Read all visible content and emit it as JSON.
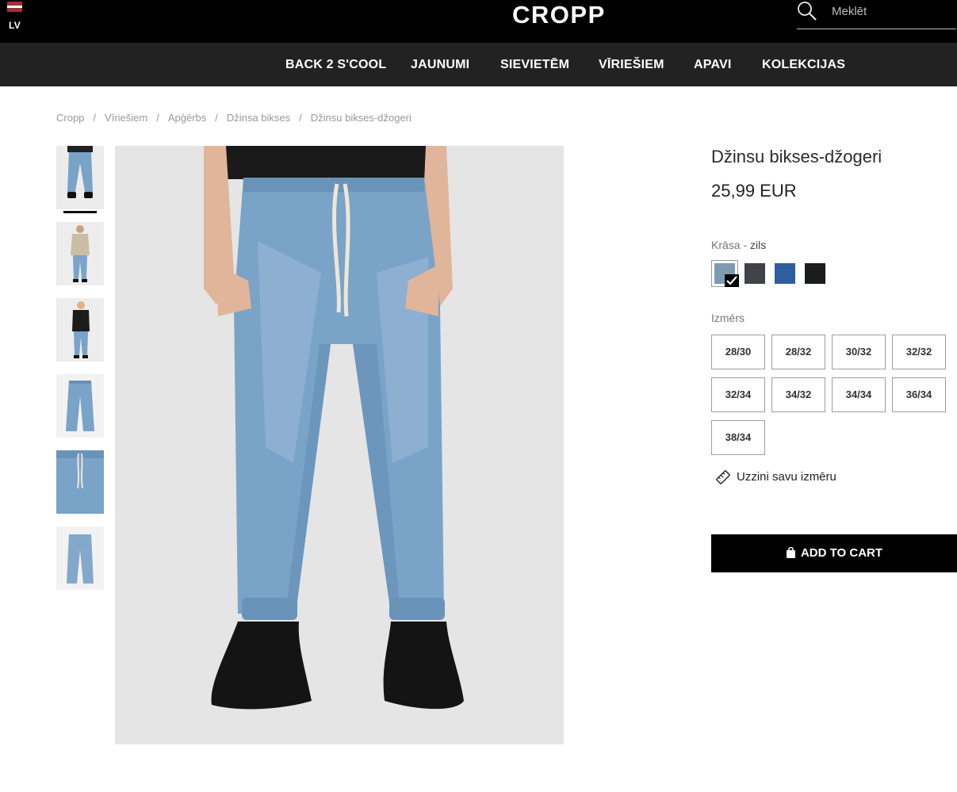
{
  "header": {
    "language": "LV",
    "logo_text": "CROPP",
    "search": {
      "placeholder": "Meklēt",
      "value": ""
    }
  },
  "nav": {
    "items": [
      {
        "label": "BACK 2 S'COOL"
      },
      {
        "label": "JAUNUMI"
      },
      {
        "label": "SIEVIETĒM"
      },
      {
        "label": "VĪRIEŠIEM"
      },
      {
        "label": "APAVI"
      },
      {
        "label": "KOLEKCIJAS"
      }
    ]
  },
  "breadcrumb": {
    "items": [
      "Cropp",
      "Vīriešiem",
      "Apģērbs",
      "Džinsa bikses",
      "Džinsu bikses-džogeri"
    ],
    "separator": "/"
  },
  "gallery": {
    "thumbnails": [
      {
        "name": "front view",
        "active": true
      },
      {
        "name": "model with jacket"
      },
      {
        "name": "back view"
      },
      {
        "name": "flat front"
      },
      {
        "name": "detail"
      },
      {
        "name": "flat back"
      }
    ]
  },
  "product": {
    "title": "Džinsu bikses-džogeri",
    "price": "25,99 EUR",
    "color_label": "Krāsa",
    "color_separator": " - ",
    "color_value": "zils",
    "colors": [
      {
        "name": "light blue",
        "hex": "#7f9bb3",
        "selected": true
      },
      {
        "name": "dark grey",
        "hex": "#3f4246"
      },
      {
        "name": "mid blue",
        "hex": "#2e5e9c"
      },
      {
        "name": "black",
        "hex": "#1b1c1e"
      }
    ],
    "size_label": "Izmērs",
    "sizes": [
      "28/30",
      "28/32",
      "30/32",
      "32/32",
      "32/34",
      "34/32",
      "34/34",
      "36/34",
      "38/34"
    ],
    "size_guide_label": "Uzzini savu izmēru",
    "add_to_cart_label": "ADD TO CART"
  },
  "colors": {
    "header_bg": "#000000",
    "nav_bg": "#222222",
    "denim": "#7aa3c8",
    "cta_bg": "#000000"
  }
}
